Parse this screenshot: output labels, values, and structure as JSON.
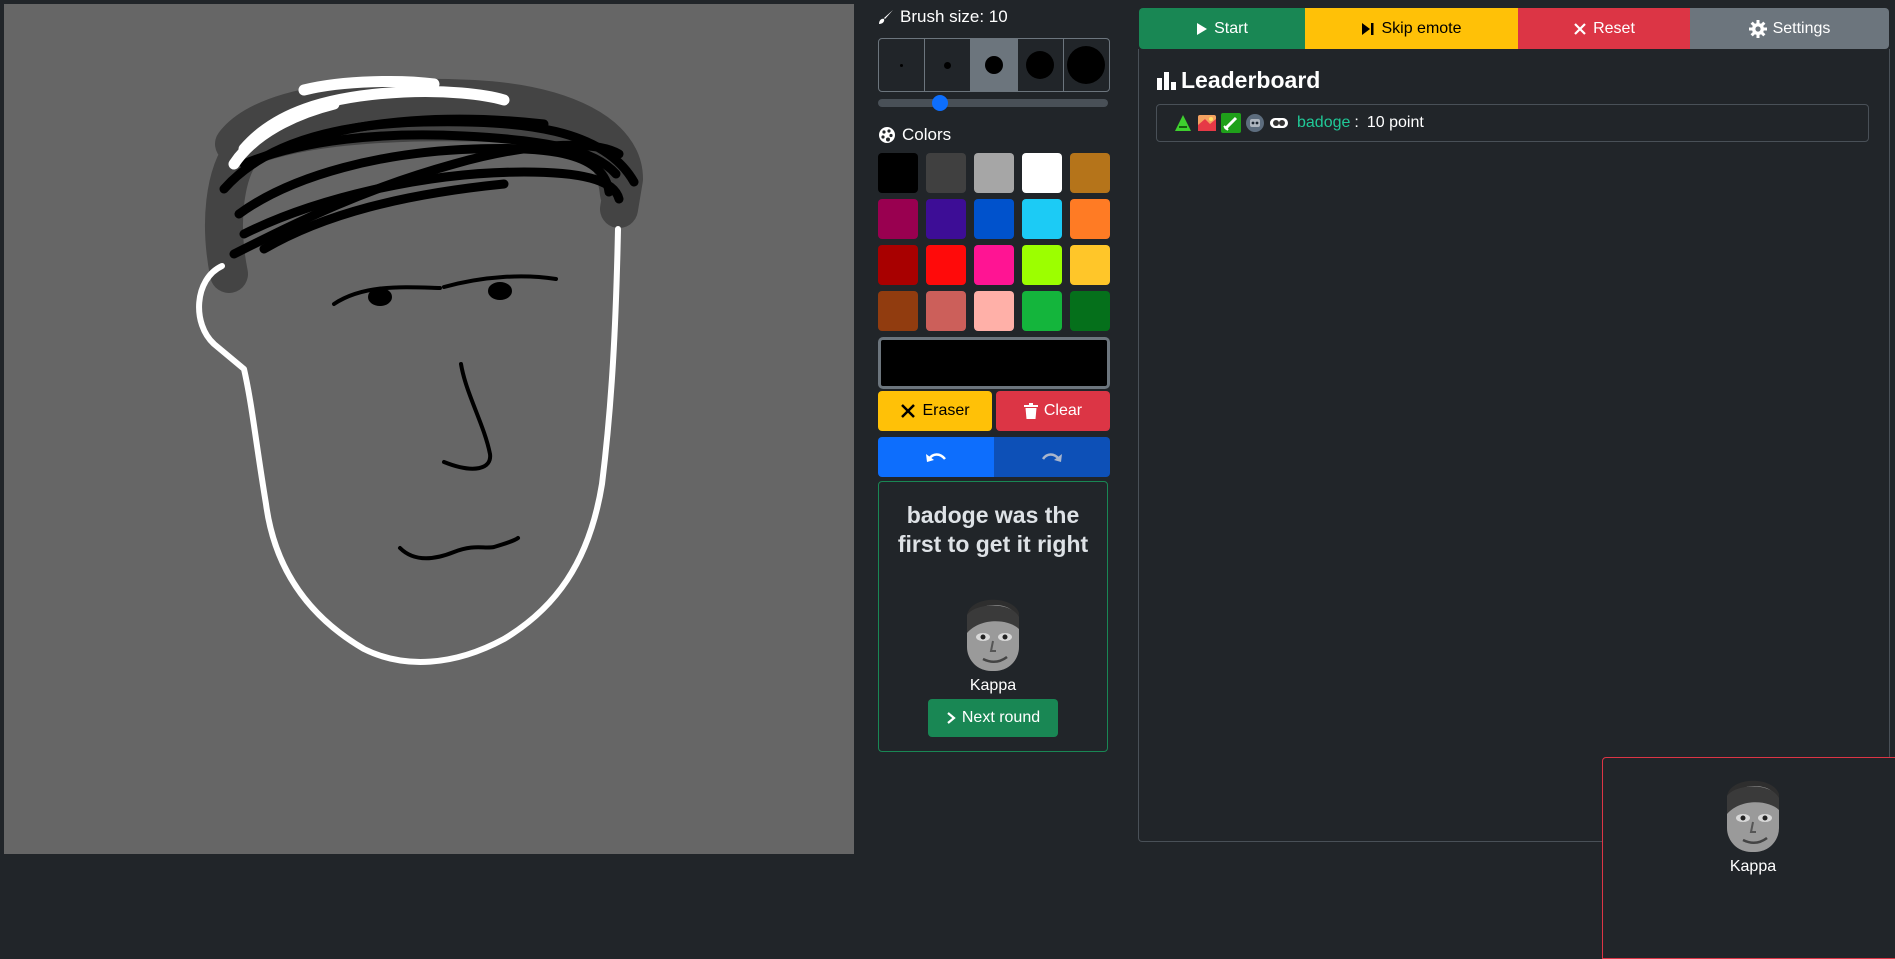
{
  "brush": {
    "label": "Brush size: 10",
    "sizes": [
      2,
      5,
      10,
      15,
      20
    ],
    "selected_index": 2,
    "slider_fraction": 0.25
  },
  "colors": {
    "label": "Colors",
    "palette": [
      "#000000",
      "#404040",
      "#a6a6a6",
      "#ffffff",
      "#b5741a",
      "#990050",
      "#3d0d96",
      "#0052cc",
      "#1ccbf5",
      "#ff7b24",
      "#a80000",
      "#ff0a0a",
      "#ff1493",
      "#9cff00",
      "#ffc629",
      "#913c0f",
      "#cc5f5a",
      "#ffb0a8",
      "#14b53c",
      "#05701b"
    ],
    "current": "#000000"
  },
  "tools": {
    "eraser_label": "Eraser",
    "clear_label": "Clear"
  },
  "result": {
    "title": "badoge was the first to get it right",
    "emote_name": "Kappa",
    "next_round_label": "Next round"
  },
  "top_buttons": {
    "start_label": "Start",
    "skip_label": "Skip emote",
    "reset_label": "Reset",
    "settings_label": "Settings"
  },
  "leaderboard": {
    "title": "Leaderboard",
    "entries": [
      {
        "name": "badoge",
        "separator": ":",
        "points_text": "10 point"
      }
    ]
  },
  "popup": {
    "emote_name": "Kappa"
  },
  "theme": {
    "background": "#212529",
    "canvas": "#666666",
    "success": "#198754",
    "warning": "#ffc107",
    "danger": "#dc3545",
    "secondary": "#6c757d",
    "primary": "#0d6efd",
    "name_accent": "#20c997"
  }
}
